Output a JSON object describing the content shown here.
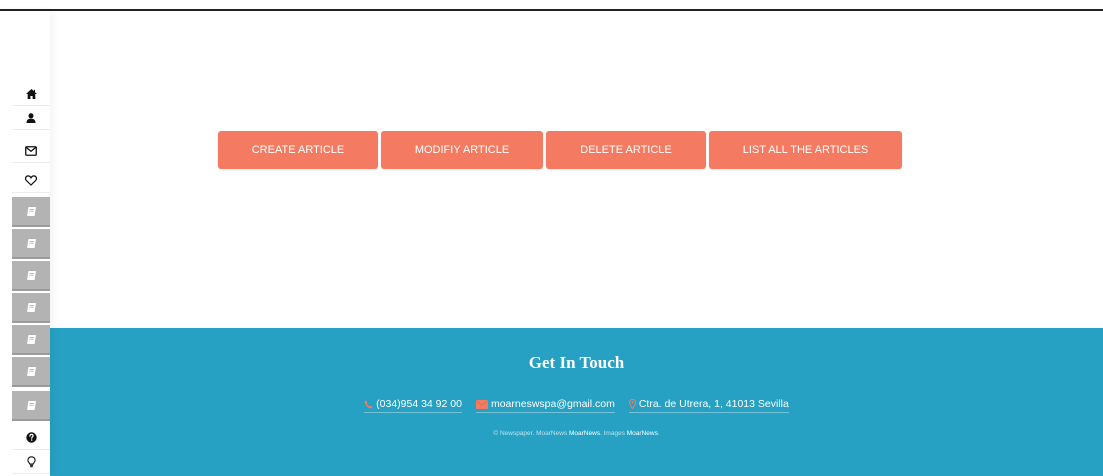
{
  "sidebar": {
    "top_items": [
      {
        "icon": "home-icon"
      },
      {
        "icon": "user-icon"
      },
      {
        "icon": "envelope-icon"
      },
      {
        "icon": "heart-icon"
      }
    ],
    "book_items": [
      {
        "icon": "book-icon"
      },
      {
        "icon": "book-icon"
      },
      {
        "icon": "book-icon"
      },
      {
        "icon": "book-icon"
      },
      {
        "icon": "book-icon"
      },
      {
        "icon": "book-icon"
      },
      {
        "icon": "book-icon"
      }
    ],
    "bottom_items": [
      {
        "icon": "question-icon"
      },
      {
        "icon": "lightbulb-icon"
      }
    ]
  },
  "actions": {
    "create": "CREATE ARTICLE",
    "modify": "MODIFIY ARTICLE",
    "delete": "DELETE ARTICLE",
    "list_all": "LIST ALL THE ARTICLES"
  },
  "footer": {
    "title": "Get In Touch",
    "phone": "(034)954 34 92 00",
    "email": "moarneswspa@gmail.com",
    "address": "Ctra. de Utrera, 1, 41013 Sevilla",
    "copyright": {
      "prefix": "© Newspaper. MoarNews",
      "brand1": "MoarNews",
      "middle": ". Images",
      "brand2": "MoarNews",
      "suffix": "."
    }
  },
  "colors": {
    "accent_button": "#f47b61",
    "footer_background": "#27a1c3",
    "contact_icon": "#f47b61"
  }
}
